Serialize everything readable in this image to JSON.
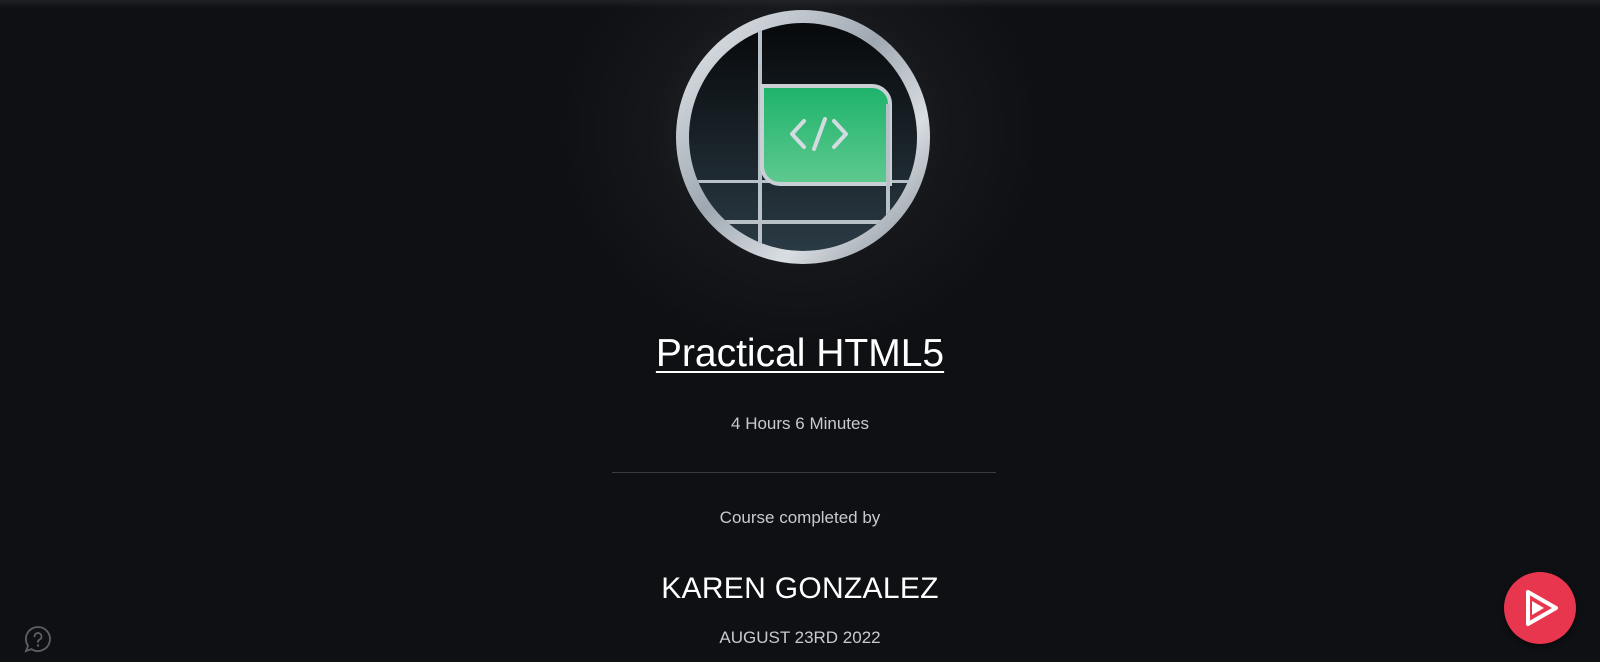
{
  "course": {
    "title": "Practical HTML5",
    "duration": "4 Hours 6 Minutes",
    "badge_icon": "code-brackets-icon"
  },
  "certificate": {
    "completed_by_label": "Course completed by",
    "recipient_name": "KAREN GONZALEZ",
    "completion_date": "AUGUST 23RD 2022"
  },
  "help": {
    "icon": "help-chat-icon"
  },
  "action": {
    "icon": "play-logo-icon"
  },
  "colors": {
    "background": "#0f1013",
    "badge_green": "#27b36e",
    "accent_red": "#e8364f",
    "muted_text": "#c9cace"
  }
}
